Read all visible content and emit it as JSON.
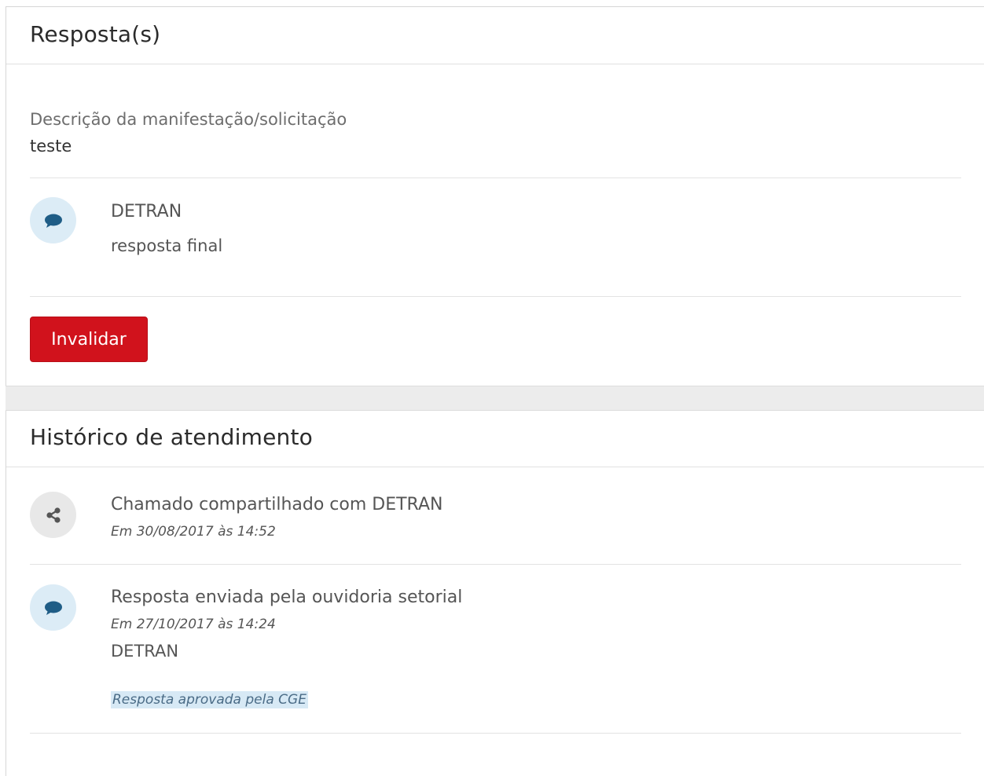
{
  "respostas_panel": {
    "title": "Resposta(s)",
    "description_label": "Descrição da manifestação/solicitação",
    "description_value": "teste",
    "response": {
      "icon": "comment-icon",
      "author": "DETRAN",
      "text": "resposta final"
    },
    "invalidate_button_label": "Invalidar"
  },
  "historico_panel": {
    "title": "Histórico de atendimento",
    "items": [
      {
        "icon": "share-icon",
        "title": "Chamado compartilhado com DETRAN",
        "date": "Em 30/08/2017 às 14:52"
      },
      {
        "icon": "comment-icon",
        "title": "Resposta enviada pela ouvidoria setorial",
        "date": "Em 27/10/2017 às 14:24",
        "org": "DETRAN",
        "note": "Resposta aprovada pela CGE"
      }
    ]
  },
  "colors": {
    "danger_button": "#d1121c",
    "icon_blue_bg": "#dcecf6",
    "icon_grey_bg": "#e8e8e8",
    "icon_blue_fg": "#1f5d86",
    "icon_grey_fg": "#555555",
    "note_highlight_bg": "#d7e9f5"
  }
}
